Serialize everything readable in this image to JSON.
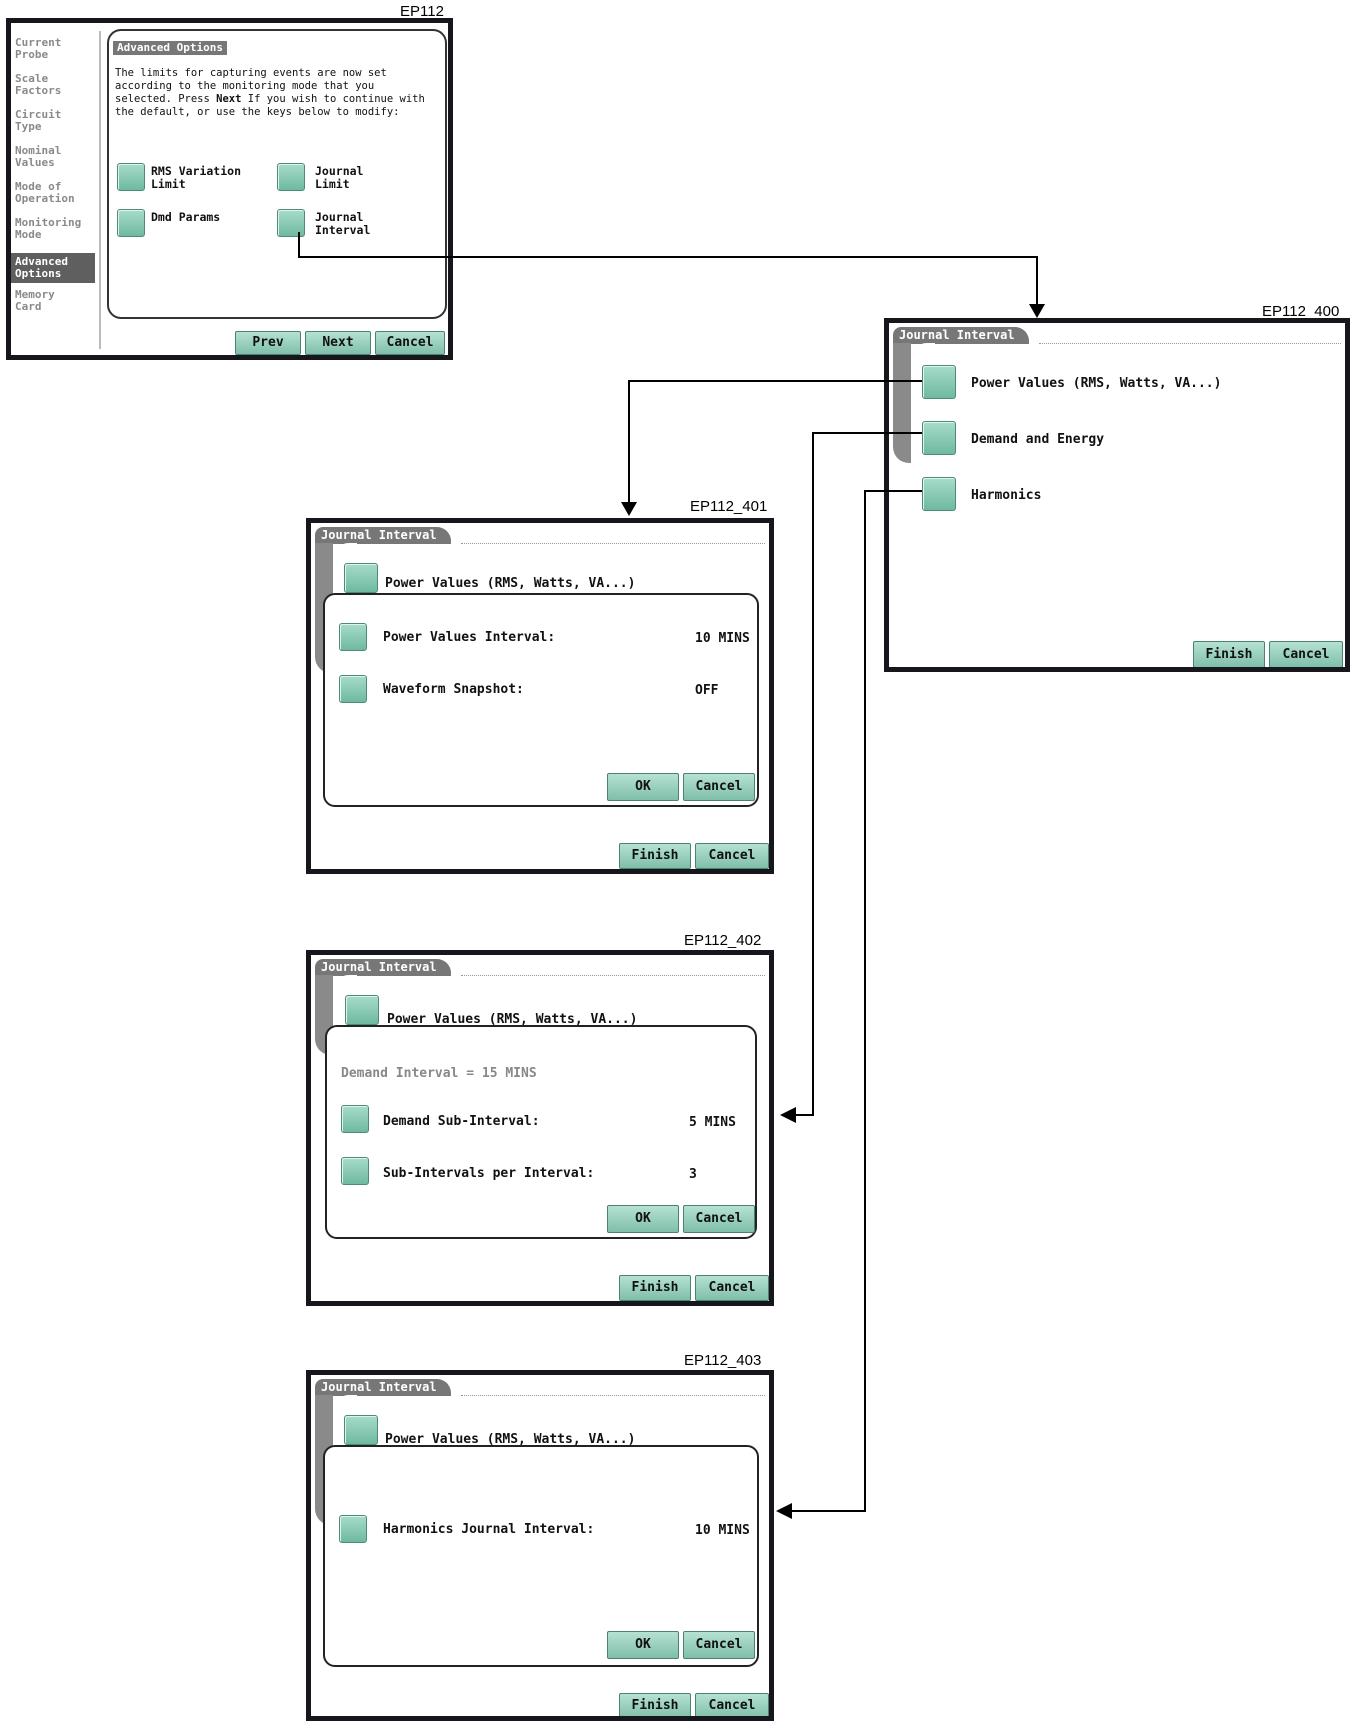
{
  "ep112": {
    "id_label": "EP112",
    "nav": [
      "Current\nProbe",
      "Scale\nFactors",
      "Circuit\nType",
      "Nominal\nValues",
      "Mode of\nOperation",
      "Monitoring\nMode",
      "Advanced\nOptions",
      "Memory\nCard"
    ],
    "active_nav": "Advanced\nOptions",
    "panel_title": "Advanced Options",
    "description_before": "The limits for capturing events are now set according to the monitoring mode that you selected. Press ",
    "description_bold": "Next",
    "description_after": " If you wish to continue with the default, or use the keys below to modify:",
    "options": {
      "rms_variation_limit": "RMS Variation\nLimit",
      "journal_limit": "Journal\nLimit",
      "dmd_params": "Dmd Params",
      "journal_interval": "Journal\nInterval"
    },
    "buttons": {
      "prev": "Prev",
      "next": "Next",
      "cancel": "Cancel"
    }
  },
  "ep112_400": {
    "id_label": "EP112_400",
    "tab_title": "Journal Interval",
    "items": [
      "Power Values (RMS, Watts, VA...)",
      "Demand and Energy",
      "Harmonics"
    ],
    "buttons": {
      "finish": "Finish",
      "cancel": "Cancel"
    }
  },
  "ep112_401": {
    "id_label": "EP112_401",
    "tab_title": "Journal Interval",
    "background_item": "Power Values (RMS, Watts, VA...)",
    "rows": [
      {
        "label": "Power Values Interval:",
        "value": "10 MINS"
      },
      {
        "label": "Waveform Snapshot:",
        "value": "OFF"
      }
    ],
    "popup_buttons": {
      "ok": "OK",
      "cancel": "Cancel"
    },
    "buttons": {
      "finish": "Finish",
      "cancel": "Cancel"
    }
  },
  "ep112_402": {
    "id_label": "EP112_402",
    "tab_title": "Journal Interval",
    "background_item": "Power Values (RMS, Watts, VA...)",
    "info": "Demand Interval = 15 MINS",
    "rows": [
      {
        "label": "Demand Sub-Interval:",
        "value": "5 MINS"
      },
      {
        "label": "Sub-Intervals per Interval:",
        "value": "3"
      }
    ],
    "popup_buttons": {
      "ok": "OK",
      "cancel": "Cancel"
    },
    "buttons": {
      "finish": "Finish",
      "cancel": "Cancel"
    }
  },
  "ep112_403": {
    "id_label": "EP112_403",
    "tab_title": "Journal Interval",
    "background_item": "Power Values (RMS, Watts, VA...)",
    "rows": [
      {
        "label": "Harmonics Journal Interval:",
        "value": "10 MINS"
      }
    ],
    "popup_buttons": {
      "ok": "OK",
      "cancel": "Cancel"
    },
    "buttons": {
      "finish": "Finish",
      "cancel": "Cancel"
    }
  },
  "colors": {
    "screen_border": "#16161c",
    "button_green": "#7fbfa9",
    "tab_gray": "#777777",
    "active_nav": "#5f5f5f"
  }
}
